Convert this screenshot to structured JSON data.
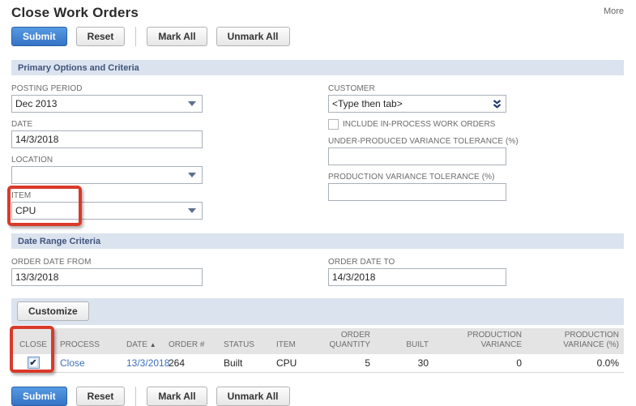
{
  "page": {
    "title": "Close Work Orders",
    "more_link": "More"
  },
  "toolbar": {
    "submit": "Submit",
    "reset": "Reset",
    "mark_all": "Mark All",
    "unmark_all": "Unmark All"
  },
  "sections": {
    "primary": "Primary Options and Criteria",
    "date_range": "Date Range Criteria"
  },
  "fields": {
    "posting_period": {
      "label": "POSTING PERIOD",
      "value": "Dec 2013"
    },
    "date": {
      "label": "DATE",
      "value": "14/3/2018"
    },
    "location": {
      "label": "LOCATION",
      "value": ""
    },
    "item": {
      "label": "ITEM",
      "value": "CPU"
    },
    "customer": {
      "label": "CUSTOMER",
      "value": "<Type then tab>"
    },
    "include_in_process": {
      "label": "INCLUDE IN-PROCESS WORK ORDERS",
      "checked": false
    },
    "under_produced_tolerance": {
      "label": "UNDER-PRODUCED VARIANCE TOLERANCE (%)",
      "value": ""
    },
    "production_tolerance": {
      "label": "PRODUCTION VARIANCE TOLERANCE (%)",
      "value": ""
    },
    "order_date_from": {
      "label": "ORDER DATE FROM",
      "value": "13/3/2018"
    },
    "order_date_to": {
      "label": "ORDER DATE TO",
      "value": "14/3/2018"
    }
  },
  "grid": {
    "customize_button": "Customize",
    "columns": [
      "CLOSE",
      "PROCESS",
      "DATE",
      "ORDER #",
      "STATUS",
      "ITEM",
      "ORDER QUANTITY",
      "BUILT",
      "PRODUCTION VARIANCE",
      "PRODUCTION VARIANCE (%)"
    ],
    "sort_column": "DATE",
    "sort_indicator": "▲",
    "rows": [
      {
        "close_checked": true,
        "process": "Close",
        "date": "13/3/2018",
        "order_number": "264",
        "status": "Built",
        "item": "CPU",
        "order_quantity": "5",
        "built": "30",
        "production_variance": "0",
        "production_variance_pct": "0.0%"
      }
    ]
  },
  "colors": {
    "primary_button_blue": "#3d7ccb",
    "section_bar_bg": "#dbe3ef",
    "section_bar_text": "#40537b",
    "highlight_red": "#d93a2b",
    "link_blue": "#3e6fba",
    "table_header_bg": "#e4e4e4"
  }
}
